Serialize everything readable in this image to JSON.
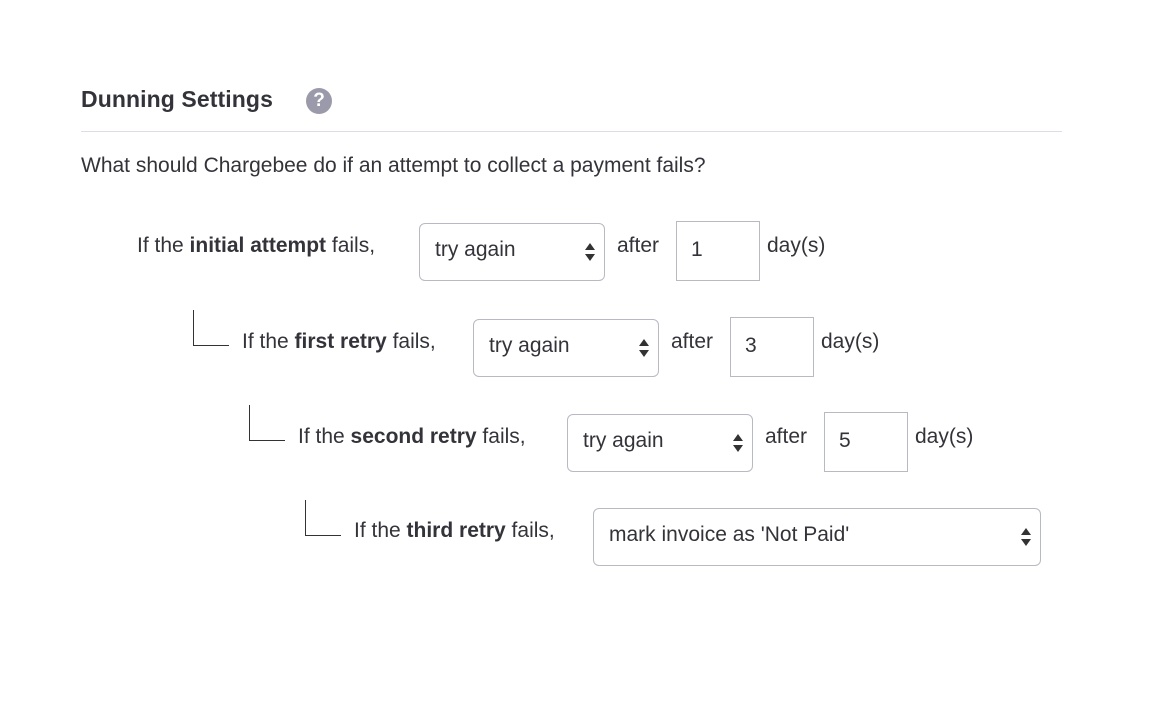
{
  "header": {
    "title": "Dunning Settings",
    "help_icon": "question-circle-icon"
  },
  "intro": "What should Chargebee do if an attempt to collect a payment fails?",
  "rules": [
    {
      "prefix": "If the ",
      "emphasis": "initial attempt",
      "suffix": " fails,",
      "action": "try again",
      "after_label": "after",
      "days": "1",
      "days_label": "day(s)"
    },
    {
      "prefix": "If the ",
      "emphasis": "first retry",
      "suffix": " fails,",
      "action": "try again",
      "after_label": "after",
      "days": "3",
      "days_label": "day(s)"
    },
    {
      "prefix": "If the ",
      "emphasis": "second retry",
      "suffix": " fails,",
      "action": "try again",
      "after_label": "after",
      "days": "5",
      "days_label": "day(s)"
    },
    {
      "prefix": "If the ",
      "emphasis": "third retry",
      "suffix": " fails,",
      "action": "mark invoice as 'Not Paid'"
    }
  ],
  "icons": {
    "select_arrows": "up-down-arrows-icon",
    "connector": "tree-connector-icon"
  }
}
